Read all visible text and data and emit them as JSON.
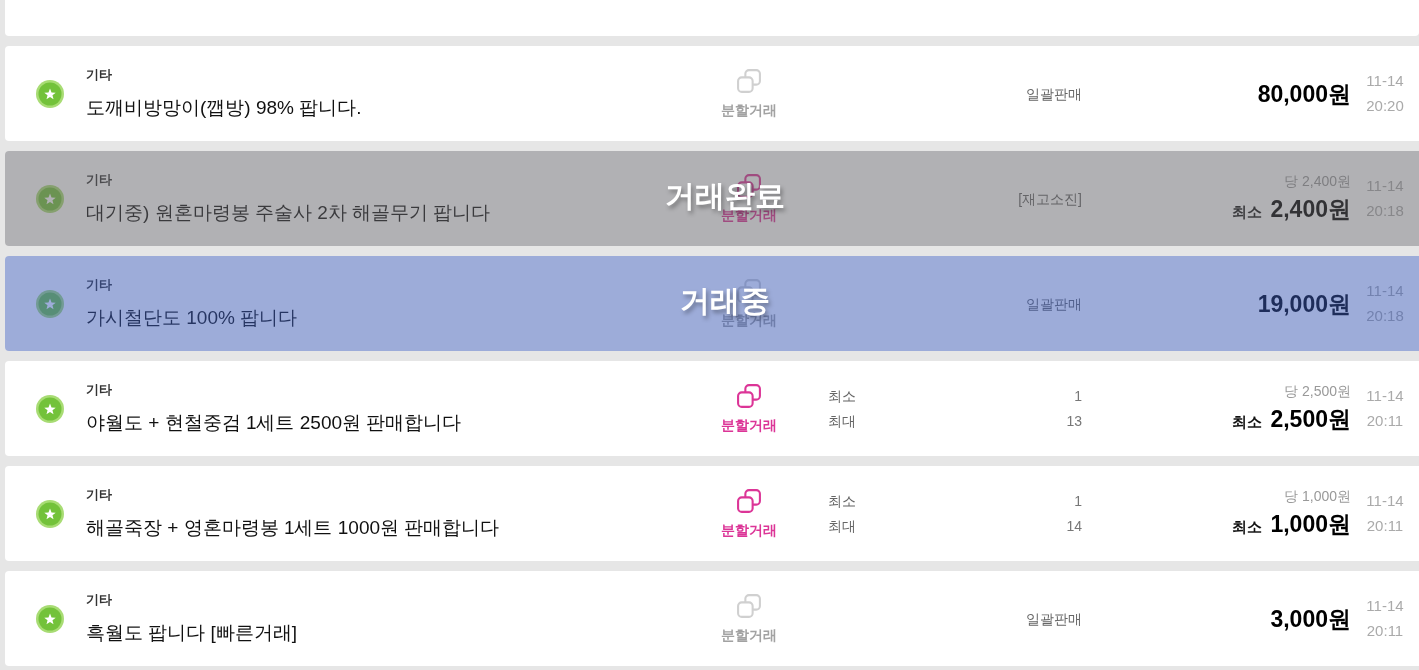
{
  "listings": [
    {
      "category": "기타",
      "title": "도깨비방망이(깹방) 98% 팝니다.",
      "split_label": "분할거래",
      "split_enabled": false,
      "quantity": {
        "kind": "note",
        "text": "일괄판매"
      },
      "price": {
        "kind": "single",
        "amount": "80,000원"
      },
      "date": "11-14",
      "time": "20:20"
    },
    {
      "category": "기타",
      "title": "대기중) 원혼마령봉 주술사 2차 해골무기 팝니다",
      "split_label": "분할거래",
      "split_enabled": true,
      "quantity": {
        "kind": "note",
        "text": "[재고소진]"
      },
      "price": {
        "kind": "per_unit",
        "unit_price": "당 2,400원",
        "min_label": "최소",
        "amount": "2,400원"
      },
      "date": "11-14",
      "time": "20:18",
      "status": {
        "kind": "completed",
        "label": "거래완료"
      }
    },
    {
      "category": "기타",
      "title": "가시철단도 100% 팝니다",
      "split_label": "분할거래",
      "split_enabled": false,
      "quantity": {
        "kind": "note",
        "text": "일괄판매"
      },
      "price": {
        "kind": "single",
        "amount": "19,000원"
      },
      "date": "11-14",
      "time": "20:18",
      "status": {
        "kind": "in_progress",
        "label": "거래중"
      }
    },
    {
      "category": "기타",
      "title": "야월도 + 현철중검 1세트 2500원 판매합니다",
      "split_label": "분할거래",
      "split_enabled": true,
      "quantity": {
        "kind": "range",
        "min_label": "최소",
        "min": "1",
        "max_label": "최대",
        "max": "13"
      },
      "price": {
        "kind": "per_unit",
        "unit_price": "당 2,500원",
        "min_label": "최소",
        "amount": "2,500원"
      },
      "date": "11-14",
      "time": "20:11"
    },
    {
      "category": "기타",
      "title": "해골죽장 + 영혼마령봉 1세트 1000원 판매합니다",
      "split_label": "분할거래",
      "split_enabled": true,
      "quantity": {
        "kind": "range",
        "min_label": "최소",
        "min": "1",
        "max_label": "최대",
        "max": "14"
      },
      "price": {
        "kind": "per_unit",
        "unit_price": "당 1,000원",
        "min_label": "최소",
        "amount": "1,000원"
      },
      "date": "11-14",
      "time": "20:11"
    },
    {
      "category": "기타",
      "title": "흑월도 팝니다 [빠른거래]",
      "split_label": "분할거래",
      "split_enabled": false,
      "quantity": {
        "kind": "note",
        "text": "일괄판매"
      },
      "price": {
        "kind": "single",
        "amount": "3,000원"
      },
      "date": "11-14",
      "time": "20:11"
    }
  ]
}
